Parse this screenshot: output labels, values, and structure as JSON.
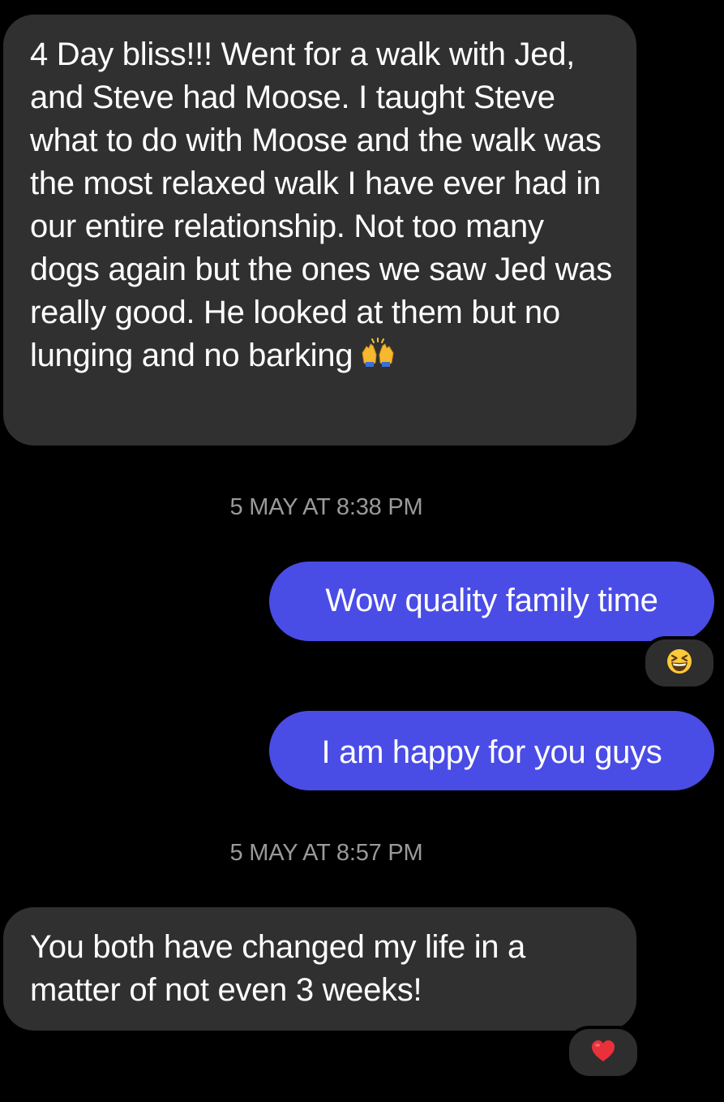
{
  "messages": [
    {
      "direction": "incoming",
      "text": "4 Day bliss!!! Went for a walk with Jed, and Steve had Moose. I taught Steve what to do with Moose and the walk was the most relaxed walk I have ever had in our entire relationship. Not too many dogs again but the ones we saw Jed was really good. He looked at them but no lunging and no barking",
      "trailing_emoji": "raising-hands-icon"
    },
    {
      "direction": "outgoing",
      "text": "Wow quality family time",
      "reaction": "grinning-squinting-face-icon"
    },
    {
      "direction": "outgoing",
      "text": "I am happy for you guys"
    },
    {
      "direction": "incoming",
      "text": "You both have changed my life in a matter of not even 3 weeks!",
      "reaction": "red-heart-icon"
    }
  ],
  "timestamps": [
    "5 MAY AT 8:38 PM",
    "5 MAY AT 8:57 PM"
  ],
  "colors": {
    "background": "#000000",
    "incoming_bubble": "#303030",
    "outgoing_bubble": "#4a4ce6",
    "timestamp_text": "#9a9a9a",
    "reaction_pill": "#2e2e2e"
  }
}
